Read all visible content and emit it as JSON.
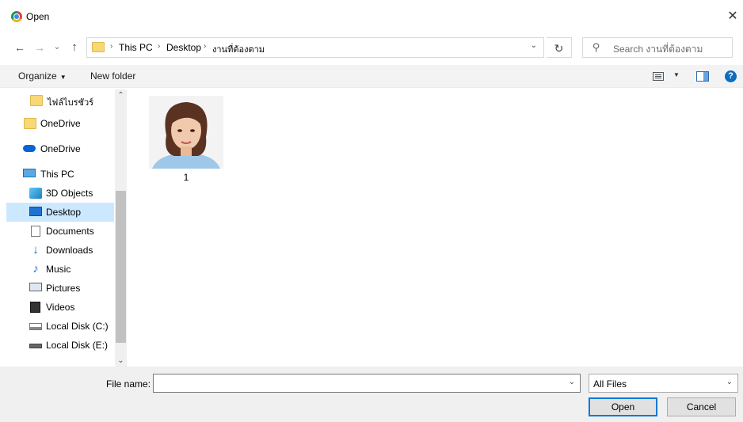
{
  "window": {
    "title": "Open",
    "close_glyph": "✕"
  },
  "nav": {
    "back_glyph": "←",
    "forward_glyph": "→",
    "recent_glyph": "⌄",
    "up_glyph": "↑"
  },
  "address": {
    "crumbs": [
      "This PC",
      "Desktop",
      "งานที่ต้องตาม"
    ],
    "separator": "›",
    "dropdown_glyph": "⌄",
    "refresh_glyph": "↻"
  },
  "search": {
    "placeholder": "Search งานที่ต้องตาม"
  },
  "toolbar": {
    "organize_label": "Organize",
    "organize_caret": "▼",
    "new_folder_label": "New folder",
    "view_caret": "▼",
    "help_label": "?"
  },
  "sidebar": {
    "items": [
      {
        "label": "ไฟล์ไบรชัวร์",
        "icon": "folder-icon"
      },
      {
        "label": "OneDrive",
        "icon": "folder-icon"
      },
      {
        "label": "OneDrive",
        "icon": "cloud-icon"
      },
      {
        "label": "This PC",
        "icon": "computer-icon"
      },
      {
        "label": "3D Objects",
        "icon": "cube-icon"
      },
      {
        "label": "Desktop",
        "icon": "desktop-icon",
        "selected": true
      },
      {
        "label": "Documents",
        "icon": "document-icon"
      },
      {
        "label": "Downloads",
        "icon": "download-icon"
      },
      {
        "label": "Music",
        "icon": "music-icon"
      },
      {
        "label": "Pictures",
        "icon": "pictures-icon"
      },
      {
        "label": "Videos",
        "icon": "video-icon"
      },
      {
        "label": "Local Disk (C:)",
        "icon": "disk-icon"
      },
      {
        "label": "Local Disk (E:)",
        "icon": "disk-icon"
      }
    ],
    "scroll_up_glyph": "⌃",
    "scroll_down_glyph": "⌄"
  },
  "files": [
    {
      "name": "1",
      "type": "image"
    }
  ],
  "footer": {
    "file_name_label": "File name:",
    "file_name_value": "",
    "file_name_dd_glyph": "⌄",
    "filter_value": "All Files",
    "filter_dd_glyph": "⌄",
    "open_label": "Open",
    "cancel_label": "Cancel"
  }
}
